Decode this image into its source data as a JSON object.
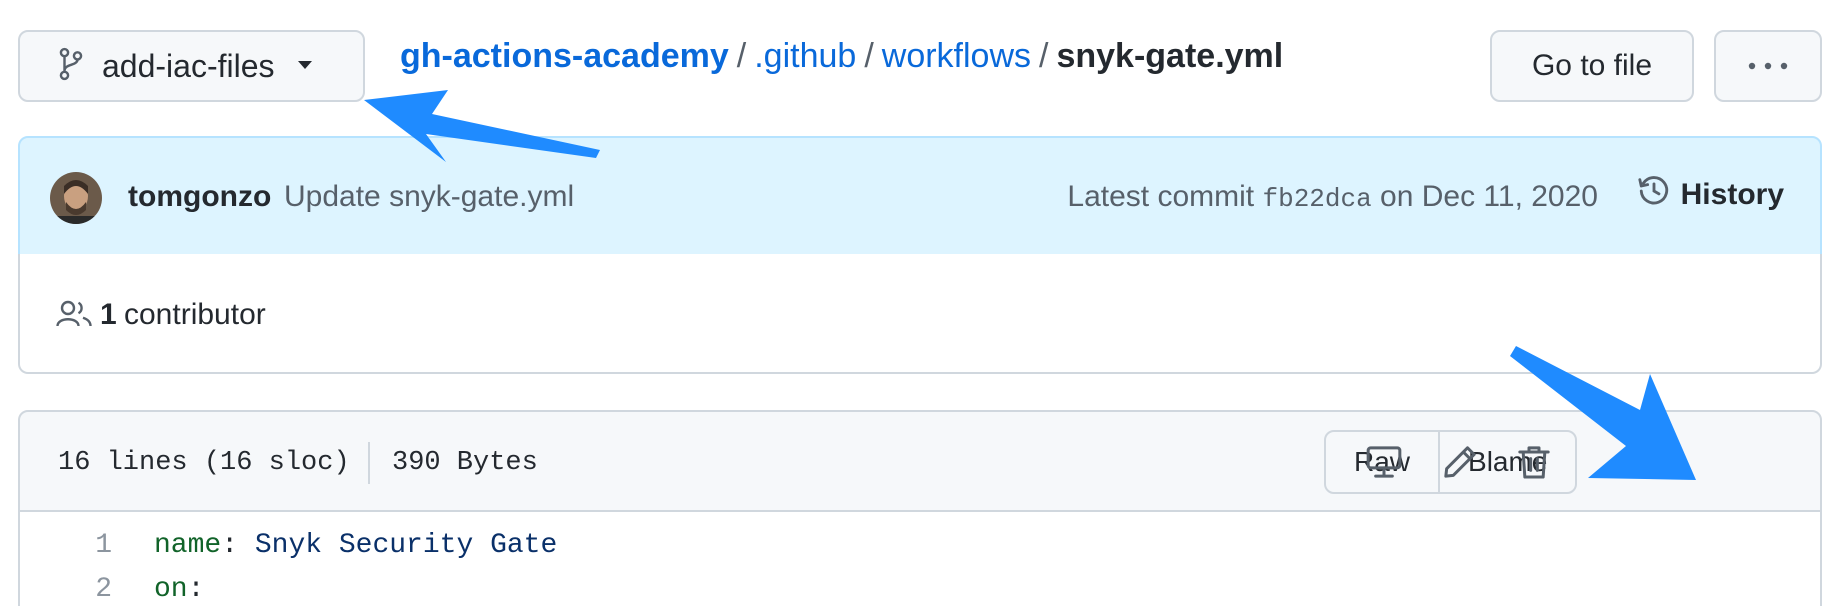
{
  "branch": {
    "name": "add-iac-files",
    "icon": "git-branch-icon"
  },
  "breadcrumb": {
    "repo": "gh-actions-academy",
    "folder1": ".github",
    "folder2": "workflows",
    "file": "snyk-gate.yml",
    "separator": "/"
  },
  "toolbar": {
    "goto_label": "Go to file",
    "more_icon": "kebab-horizontal-icon"
  },
  "commit": {
    "author": "tomgonzo",
    "message": "Update snyk-gate.yml",
    "prefix": "Latest commit",
    "sha": "fb22dca",
    "date": "on Dec 11, 2020",
    "history_label": "History"
  },
  "contributors": {
    "count": "1",
    "label": "contributor"
  },
  "file": {
    "lines_info": "16 lines (16 sloc)",
    "size": "390 Bytes",
    "raw_label": "Raw",
    "blame_label": "Blame"
  },
  "code": {
    "lines": [
      {
        "num": "1",
        "key": "name",
        "colon": ":",
        "value": " Snyk Security Gate"
      },
      {
        "num": "2",
        "key": "on",
        "colon": ":",
        "value": ""
      }
    ]
  },
  "colors": {
    "link": "#0969da",
    "annotation_arrow": "#1f8bff",
    "commit_bg": "#ddf4ff"
  }
}
